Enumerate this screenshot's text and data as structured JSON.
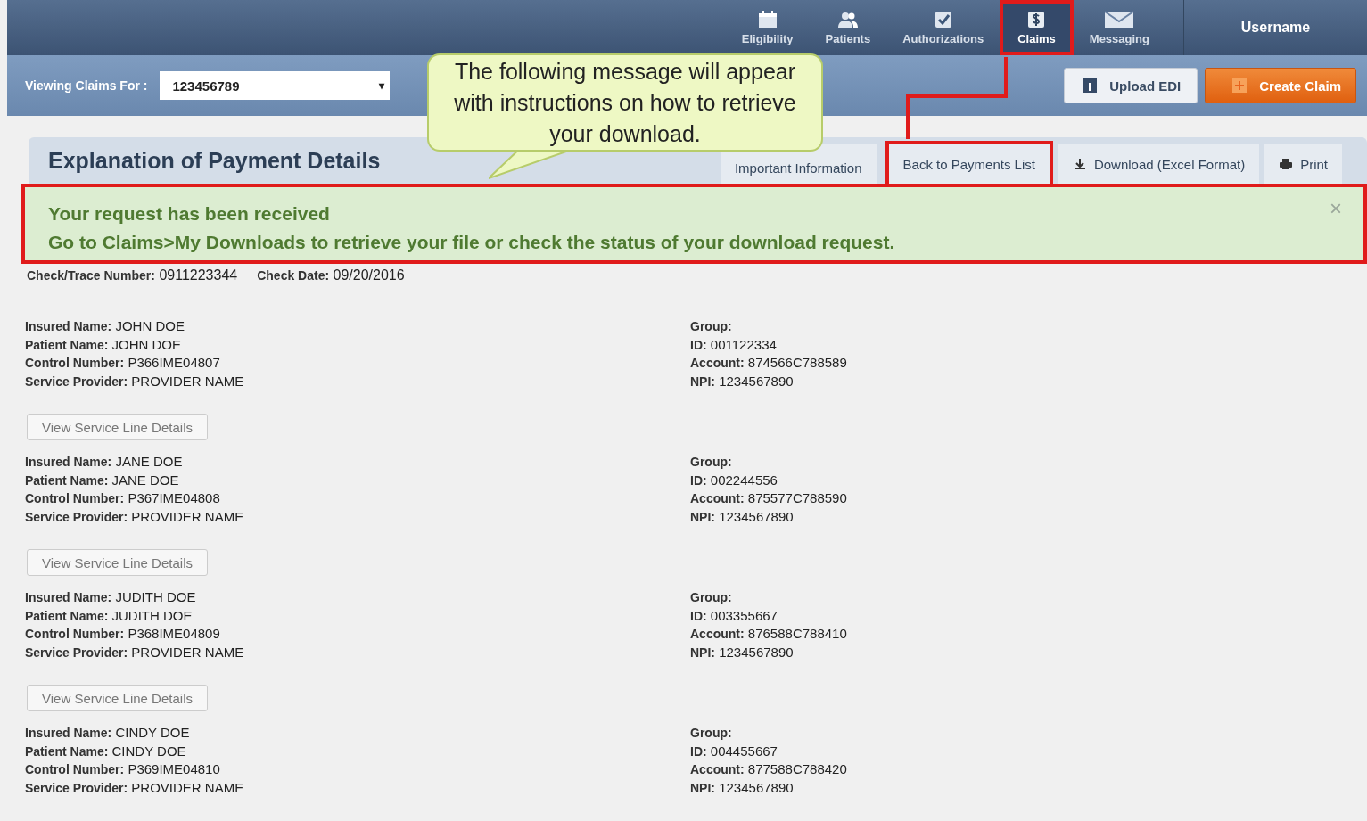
{
  "nav": {
    "items": [
      {
        "label": "Eligibility",
        "selected": false,
        "highlighted": false
      },
      {
        "label": "Patients",
        "selected": false,
        "highlighted": false
      },
      {
        "label": "Authorizations",
        "selected": false,
        "highlighted": false
      },
      {
        "label": "Claims",
        "selected": true,
        "highlighted": true
      },
      {
        "label": "Messaging",
        "selected": false,
        "highlighted": false
      }
    ],
    "user": "Username"
  },
  "toolbar": {
    "label": "Viewing Claims For :",
    "select_value": "123456789",
    "select_caret": "▾",
    "buttons": [
      {
        "label": "Upload EDI",
        "kind": "secondary"
      },
      {
        "label": "Create Claim",
        "kind": "primary"
      }
    ]
  },
  "callout": {
    "text": "The following message will appear with instructions on how to retrieve your download."
  },
  "header": {
    "title": "Explanation of Payment Details",
    "tabs": [
      {
        "label": "Important Information",
        "kind": "plain",
        "highlighted": false
      },
      {
        "label": "Back to Payments List",
        "kind": "plain",
        "highlighted": true
      },
      {
        "label": "Download (Excel Format)",
        "kind": "download",
        "highlighted": false
      },
      {
        "label": "Print",
        "kind": "print",
        "highlighted": false
      }
    ]
  },
  "alert": {
    "title": "Your request has been received",
    "message": "Go to Claims>My Downloads to retrieve your file or check the status of your download request.",
    "close": "×",
    "highlighted": true
  },
  "check": [
    {
      "label": "Check/Trace Number:",
      "value": "0911223344"
    },
    {
      "label": "Check Date:",
      "value": "09/20/2016"
    }
  ],
  "records": [
    {
      "left": [
        {
          "label": "Insured Name:",
          "value": "JOHN DOE"
        },
        {
          "label": "Patient Name:",
          "value": "JOHN DOE"
        },
        {
          "label": "Control Number:",
          "value": "P366IME04807"
        },
        {
          "label": "Service Provider:",
          "value": "PROVIDER NAME"
        }
      ],
      "right": [
        {
          "label": "Group:"
        },
        {
          "label": "ID:",
          "value": "001122334"
        },
        {
          "label": "Account:",
          "value": "874566C788589"
        },
        {
          "label": "NPI:",
          "value": "1234567890"
        }
      ],
      "button": "View Service Line Details"
    },
    {
      "left": [
        {
          "label": "Insured Name:",
          "value": "JANE DOE"
        },
        {
          "label": "Patient Name:",
          "value": "JANE DOE"
        },
        {
          "label": "Control Number:",
          "value": "P367IME04808"
        },
        {
          "label": "Service Provider:",
          "value": "PROVIDER NAME"
        }
      ],
      "right": [
        {
          "label": "Group:"
        },
        {
          "label": "ID:",
          "value": "002244556"
        },
        {
          "label": "Account:",
          "value": "875577C788590"
        },
        {
          "label": "NPI:",
          "value": "1234567890"
        }
      ],
      "button": "View Service Line Details"
    },
    {
      "left": [
        {
          "label": "Insured Name:",
          "value": "JUDITH DOE"
        },
        {
          "label": "Patient Name:",
          "value": "JUDITH DOE"
        },
        {
          "label": "Control Number:",
          "value": "P368IME04809"
        },
        {
          "label": "Service Provider:",
          "value": "PROVIDER NAME"
        }
      ],
      "right": [
        {
          "label": "Group:"
        },
        {
          "label": "ID:",
          "value": "003355667"
        },
        {
          "label": "Account:",
          "value": "876588C788410"
        },
        {
          "label": "NPI:",
          "value": "1234567890"
        }
      ],
      "button": "View Service Line Details"
    },
    {
      "left": [
        {
          "label": "Insured Name:",
          "value": "CINDY DOE"
        },
        {
          "label": "Patient Name:",
          "value": "CINDY DOE"
        },
        {
          "label": "Control Number:",
          "value": "P369IME04810"
        },
        {
          "label": "Service Provider:",
          "value": "PROVIDER NAME"
        }
      ],
      "right": [
        {
          "label": "Group:"
        },
        {
          "label": "ID:",
          "value": "004455667"
        },
        {
          "label": "Account:",
          "value": "877588C788420"
        },
        {
          "label": "NPI:",
          "value": "1234567890"
        }
      ]
    }
  ]
}
